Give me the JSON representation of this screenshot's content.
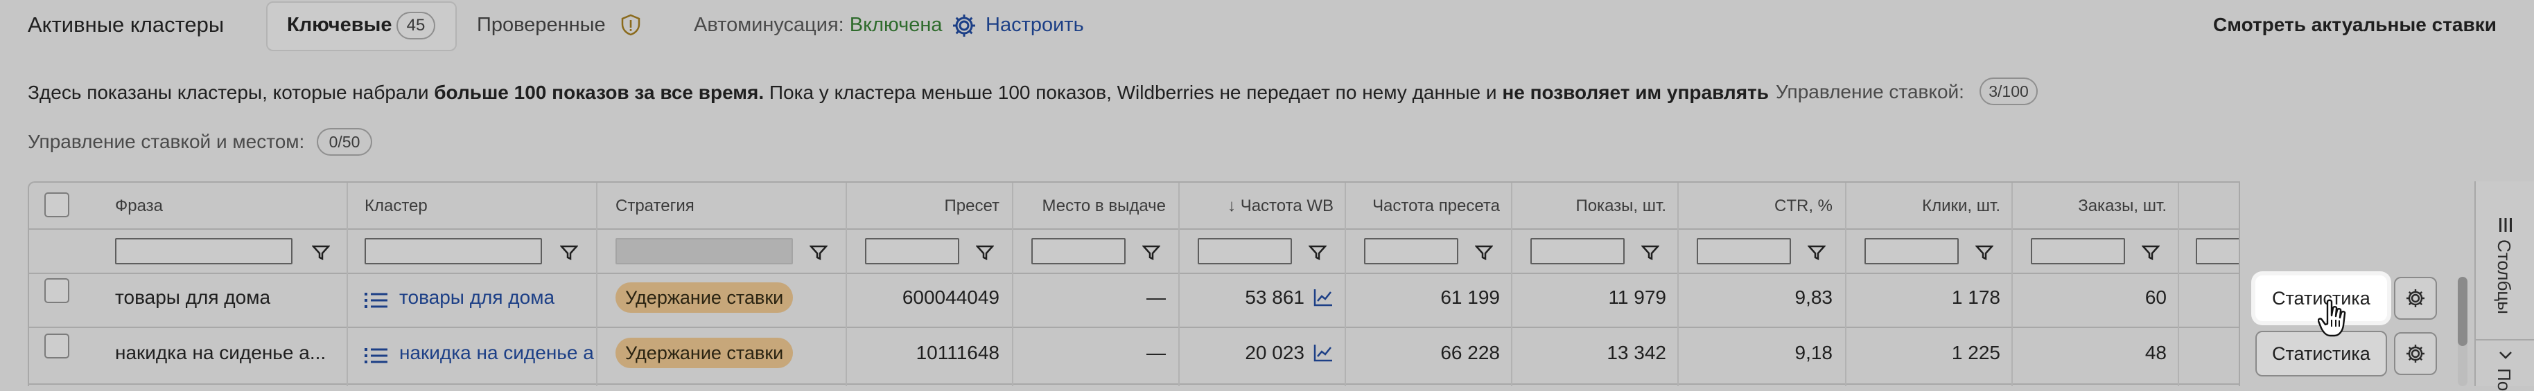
{
  "top_bar": {
    "title": "Активные кластеры",
    "tabs": [
      {
        "label": "Ключевые",
        "count": "45",
        "active": true
      },
      {
        "label": "Проверенные",
        "icon": "shield-warning-icon"
      }
    ],
    "autominus_label": "Автоминусация: ",
    "autominus_value": "Включена",
    "configure_label": "Настроить",
    "view_rates_button": "Смотреть актуальные ставки"
  },
  "info": {
    "part1": "Здесь показаны кластеры, которые набрали ",
    "part2_bold": "больше 100 показов за все время.",
    "part3": " Пока у кластера меньше 100 показов, Wildberries не передает по нему данные и ",
    "part4_bold": "не позволяет им управлять",
    "rate_management_label": "Управление ставкой:",
    "rate_management_count": "3/100",
    "rate_place_management_label": "Управление ставкой и местом:",
    "rate_place_management_count": "0/50"
  },
  "table": {
    "columns": [
      "Фраза",
      "Кластер",
      "Стратегия",
      "Пресет",
      "Место в выдаче",
      "↓ Частота WB",
      "Частота пресета",
      "Показы, шт.",
      "CTR, %",
      "Клики, шт.",
      "Заказы, шт."
    ],
    "rows": [
      {
        "phrase": "товары для дома",
        "cluster": "товары для дома",
        "strategy": "Удержание ставки",
        "preset": "600044049",
        "place": "—",
        "freq_wb": "53 861",
        "freq_preset": "61 199",
        "impressions": "11 979",
        "ctr": "9,83",
        "clicks": "1 178",
        "orders": "60"
      },
      {
        "phrase": "накидка на сиденье а...",
        "cluster": "накидка на сиденье авто",
        "strategy": "Удержание ставки",
        "preset": "10111648",
        "place": "—",
        "freq_wb": "20 023",
        "freq_preset": "66 228",
        "impressions": "13 342",
        "ctr": "9,18",
        "clicks": "1 225",
        "orders": "48"
      }
    ],
    "stats_button": "Статистика",
    "side_panel": [
      "Столбцы",
      "По"
    ]
  },
  "colors": {
    "link": "#1c3f86",
    "enabled": "#2e6b2c",
    "strategy_badge": "#c7a77a",
    "overlay_bg": "#c6c6c6"
  }
}
